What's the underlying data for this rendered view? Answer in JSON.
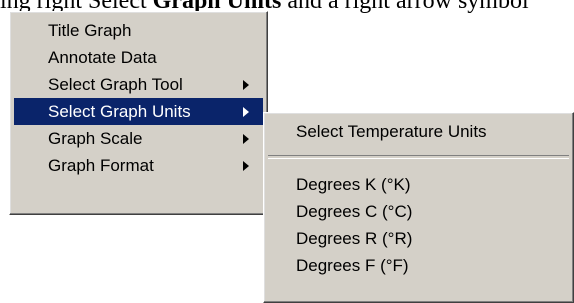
{
  "document": {
    "text_before": "ing right Select ",
    "text_bold": "Graph Units",
    "text_after": " and a right arrow symbol"
  },
  "main_menu": {
    "items": [
      {
        "label": "Title Graph",
        "has_submenu": false
      },
      {
        "label": "Annotate Data",
        "has_submenu": false
      },
      {
        "label": "Select Graph Tool",
        "has_submenu": true
      },
      {
        "label": "Select Graph Units",
        "has_submenu": true,
        "selected": true
      },
      {
        "label": "Graph Scale",
        "has_submenu": true
      },
      {
        "label": "Graph Format",
        "has_submenu": true
      }
    ]
  },
  "sub_menu": {
    "header": "Select Temperature Units",
    "items": [
      {
        "label": "Degrees K (°K)"
      },
      {
        "label": "Degrees C (°C)"
      },
      {
        "label": "Degrees R (°R)"
      },
      {
        "label": "Degrees F (°F)"
      }
    ]
  },
  "colors": {
    "menu_bg": "#d4d0c8",
    "highlight_bg": "#0a246a",
    "highlight_text": "#ffffff"
  }
}
